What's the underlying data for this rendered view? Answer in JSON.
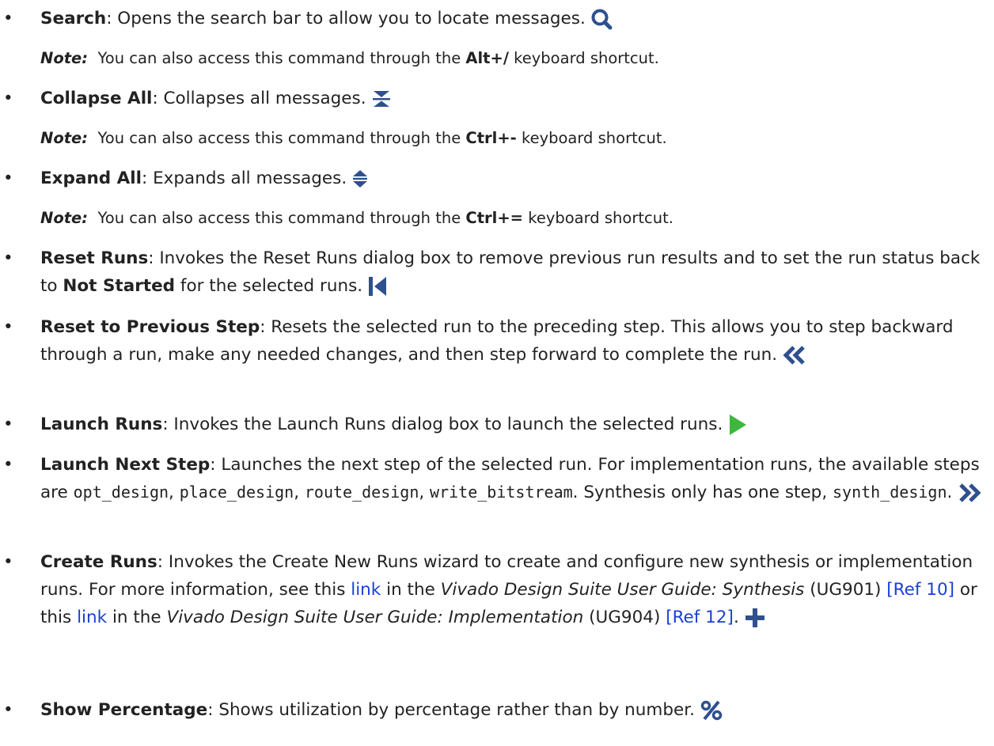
{
  "bullet": "•",
  "note_label": "Note:",
  "note_prefix": "You can also access this command through the",
  "note_suffix": "keyboard shortcut.",
  "items": [
    {
      "name": "Search",
      "desc": ": Opens the search bar to allow you to locate messages.",
      "icon": "search-icon",
      "shortcut": "Alt+/"
    },
    {
      "name": "Collapse All",
      "desc": ": Collapses all messages.",
      "icon": "collapse-all-icon",
      "shortcut": "Ctrl+-"
    },
    {
      "name": "Expand All",
      "desc": ": Expands all messages.",
      "icon": "expand-all-icon",
      "shortcut": "Ctrl+="
    },
    {
      "name": "Reset Runs",
      "desc_a": ": Invokes the Reset Runs dialog box to remove previous run results and to set the run status back to ",
      "desc_bold": "Not Started",
      "desc_b": " for the selected runs.",
      "icon": "reset-runs-icon"
    },
    {
      "name": "Reset to Previous Step",
      "desc": ": Resets the selected run to the preceding step. This allows you to step backward through a run, make any needed changes, and then step forward to complete the run.",
      "icon": "reset-previous-step-icon"
    },
    {
      "name": "Launch Runs",
      "desc": ": Invokes the Launch Runs dialog box to launch the selected runs.",
      "icon": "launch-runs-icon"
    },
    {
      "name": "Launch Next Step",
      "desc_a": ": Launches the next step of the selected run. For implementation runs, the available steps are ",
      "code1": "opt_design",
      "sep1": ", ",
      "code2": "place_design",
      "sep2": ", ",
      "code3": "route_design",
      "sep3": ", ",
      "code4": "write_bitstream",
      "desc_b": ". Synthesis only has one step, ",
      "code5": "synth_design",
      "desc_c": ".",
      "icon": "launch-next-step-icon"
    },
    {
      "name": "Create Runs",
      "desc_a": ": Invokes the Create New Runs wizard to create and configure new synthesis or implementation runs. For more information, see this ",
      "link1": "link",
      "desc_b": " in the ",
      "book1": "Vivado Design Suite User Guide: Synthesis",
      "doc1": " (UG901) ",
      "ref1": "[Ref 10]",
      "desc_c": " or this ",
      "link2": "link",
      "desc_d": " in the ",
      "book2": "Vivado Design Suite User Guide: Implementation",
      "doc2": " (UG904) ",
      "ref2": "[Ref 12]",
      "desc_e": ".",
      "icon": "create-runs-icon"
    },
    {
      "name": "Show Percentage",
      "desc": ": Shows utilization by percentage rather than by number.",
      "icon": "percentage-icon"
    }
  ],
  "colors": {
    "icon_blue": "#2f4f8f",
    "launch_green": "#3db83d",
    "link": "#1a3fd6"
  }
}
